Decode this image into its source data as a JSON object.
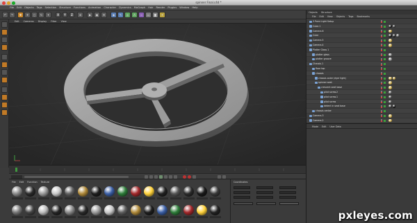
{
  "window": {
    "title": "spinner Final.c4d *"
  },
  "menubar": [
    "File",
    "Edit",
    "Objects",
    "Tags",
    "Selection",
    "Structure",
    "Functions",
    "Animation",
    "Character",
    "Dynamics",
    "MoGraph",
    "Hair",
    "Render",
    "Plugins",
    "Window",
    "Help"
  ],
  "toolbar": {
    "xyz": [
      "X",
      "Y",
      "Z"
    ]
  },
  "viewport": {
    "menu": [
      "Edit",
      "Cameras",
      "Display",
      "Filter",
      "View"
    ],
    "label": "Perspective"
  },
  "material_manager": {
    "menu": [
      "File",
      "Edit",
      "Function",
      "Texture"
    ]
  },
  "coordinates": {
    "label": "Coordinates"
  },
  "object_manager": {
    "tabs": [
      "Objects",
      "Structure"
    ],
    "menu": [
      "File",
      "Edit",
      "View",
      "Objects",
      "Tags",
      "Bookmarks"
    ],
    "rows": [
      {
        "name": "3 Point Light Setup",
        "indent": 0,
        "tags": []
      },
      {
        "name": "Cube.1",
        "indent": 0,
        "tags": [
          "#111",
          "#333"
        ]
      },
      {
        "name": "Camera.6",
        "indent": 0,
        "tags": [
          "#c9a94a"
        ]
      },
      {
        "name": "Cube",
        "indent": 0,
        "tags": [
          "#111",
          "#222",
          "#444"
        ]
      },
      {
        "name": "Camera.5",
        "indent": 0,
        "tags": [
          "#c9a94a"
        ]
      },
      {
        "name": "Camera.4",
        "indent": 0,
        "tags": [
          "#c9a94a"
        ]
      },
      {
        "name": "Platter Glass 1",
        "indent": 0,
        "tags": []
      },
      {
        "name": "platter glass",
        "indent": 1,
        "tags": [
          "#888"
        ]
      },
      {
        "name": "platter groove",
        "indent": 1,
        "tags": [
          "#888"
        ]
      },
      {
        "name": "Chassis.1",
        "indent": 0,
        "tags": []
      },
      {
        "name": "floor top",
        "indent": 1,
        "tags": []
      },
      {
        "name": "chassis",
        "indent": 1,
        "tags": []
      },
      {
        "name": "chassis outer (dyer light)",
        "indent": 2,
        "tags": [
          "#c9a94a",
          "#c9a94a"
        ]
      },
      {
        "name": "spinner seat",
        "indent": 2,
        "tags": [
          "#c9a94a"
        ]
      },
      {
        "name": "crescent seat base",
        "indent": 3,
        "tags": [
          "#c9a94a"
        ]
      },
      {
        "name": "pilot screw.2",
        "indent": 4,
        "tags": [
          "#555"
        ]
      },
      {
        "name": "pilot screw.1",
        "indent": 4,
        "tags": [
          "#555"
        ]
      },
      {
        "name": "pilot screw",
        "indent": 4,
        "tags": [
          "#555"
        ]
      },
      {
        "name": "detent in seat base",
        "indent": 4,
        "tags": [
          "#333",
          "#111"
        ]
      },
      {
        "name": "chassis center",
        "indent": 1,
        "tags": []
      },
      {
        "name": "Camera.3",
        "indent": 0,
        "tags": [
          "#c9a94a"
        ]
      },
      {
        "name": "Camera.2",
        "indent": 0,
        "tags": [
          "#c9a94a"
        ]
      }
    ]
  },
  "attribute_manager": {
    "menu": [
      "Mode",
      "Edit",
      "User Data"
    ]
  },
  "materials": [
    {
      "color": "#8a8a8a"
    },
    {
      "color": "#2a2a2a"
    },
    {
      "color": "#9b9b9b"
    },
    {
      "color": "#c9c9c9"
    },
    {
      "color": "#5f5f5f"
    },
    {
      "color": "#b08a3a"
    },
    {
      "color": "#1e1e1e"
    },
    {
      "color": "#3b5fa6"
    },
    {
      "color": "#2e7d3a"
    },
    {
      "color": "#a3282a"
    },
    {
      "color": "#ffd13a"
    },
    {
      "color": "#222222"
    },
    {
      "color": "#555555"
    },
    {
      "color": "#2b2b2b"
    },
    {
      "color": "#1a1a1a"
    },
    {
      "color": "#3a3a3a"
    },
    {
      "color": "#777777"
    },
    {
      "color": "#444444"
    },
    {
      "color": "#bdbdbd"
    },
    {
      "color": "#262626"
    }
  ],
  "watermark": "pxleyes.com"
}
